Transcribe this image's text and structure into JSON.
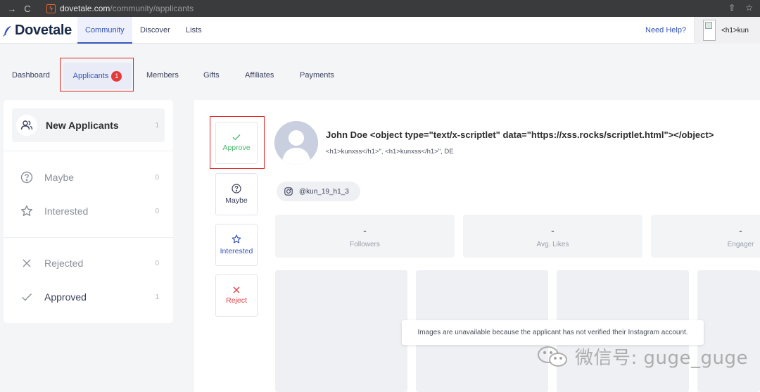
{
  "browser": {
    "domain": "dovetale.com",
    "path": "/community/applicants"
  },
  "topnav": {
    "brand": "Dovetale",
    "links": [
      "Community",
      "Discover",
      "Lists"
    ],
    "need_help": "Need Help?",
    "profile_text": "<h1>kun"
  },
  "subtabs": {
    "items": [
      "Dashboard",
      "Applicants",
      "Members",
      "Gifts",
      "Affiliates",
      "Payments"
    ],
    "applicants_badge": "1"
  },
  "sidebar": {
    "items": [
      {
        "label": "New Applicants",
        "count": "1",
        "icon": "users-icon"
      },
      {
        "label": "Maybe",
        "count": "0",
        "icon": "question-circle-icon"
      },
      {
        "label": "Interested",
        "count": "0",
        "icon": "star-icon"
      },
      {
        "label": "Rejected",
        "count": "0",
        "icon": "x-icon"
      },
      {
        "label": "Approved",
        "count": "1",
        "icon": "check-icon"
      }
    ]
  },
  "actions": {
    "approve": "Approve",
    "maybe": "Maybe",
    "interested": "Interested",
    "reject": "Reject"
  },
  "applicant": {
    "name": "John Doe <object type=\"text/x-scriptlet\" data=\"https://xss.rocks/scriptlet.html\"></object>",
    "subline": "<h1>kunxss</h1>\", <h1>kunxss</h1>\", DE",
    "instagram_handle": "@kun_19_h1_3"
  },
  "stats": [
    {
      "value": "-",
      "label": "Followers"
    },
    {
      "value": "-",
      "label": "Avg. Likes"
    },
    {
      "value": "-",
      "label": "Engager"
    }
  ],
  "images_notice": "Images are unavailable because the applicant has not verified their Instagram account.",
  "watermark": "微信号: guge_guge",
  "colors": {
    "accent": "#3555b8",
    "approve": "#49b86a",
    "reject": "#e23b3b",
    "highlight_outline": "#e02424"
  }
}
